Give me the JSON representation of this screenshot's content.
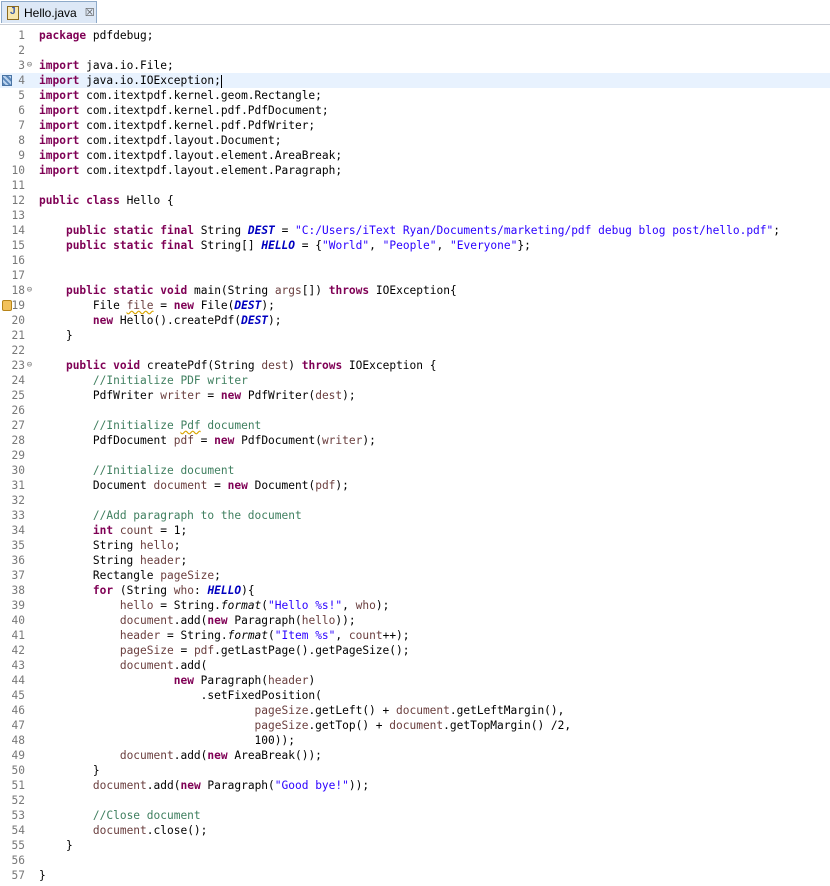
{
  "tab": {
    "title": "Hello.java",
    "close_glyph": "☒",
    "icon": "java-file-icon"
  },
  "colors": {
    "keyword": "#7f0055",
    "string": "#2a00ff",
    "comment": "#3f7f5f",
    "field": "#0000c0",
    "line_number": "#787878",
    "current_line": "#e8f2fe"
  },
  "editor": {
    "current_line": 4,
    "lines": [
      {
        "n": "1",
        "seg": [
          [
            "kw",
            "package"
          ],
          [
            "t",
            " pdfdebug;"
          ]
        ]
      },
      {
        "n": "2",
        "seg": []
      },
      {
        "n": "3",
        "fold": "⊖",
        "seg": [
          [
            "kw",
            "import"
          ],
          [
            "t",
            " java.io.File;"
          ]
        ]
      },
      {
        "n": "4",
        "marker": "change",
        "cursor": true,
        "seg": [
          [
            "kw",
            "import"
          ],
          [
            "t",
            " java.io.IOException;"
          ]
        ]
      },
      {
        "n": "5",
        "seg": [
          [
            "kw",
            "import"
          ],
          [
            "t",
            " com.itextpdf.kernel.geom.Rectangle;"
          ]
        ]
      },
      {
        "n": "6",
        "seg": [
          [
            "kw",
            "import"
          ],
          [
            "t",
            " com.itextpdf.kernel.pdf.PdfDocument;"
          ]
        ]
      },
      {
        "n": "7",
        "seg": [
          [
            "kw",
            "import"
          ],
          [
            "t",
            " com.itextpdf.kernel.pdf.PdfWriter;"
          ]
        ]
      },
      {
        "n": "8",
        "seg": [
          [
            "kw",
            "import"
          ],
          [
            "t",
            " com.itextpdf.layout.Document;"
          ]
        ]
      },
      {
        "n": "9",
        "seg": [
          [
            "kw",
            "import"
          ],
          [
            "t",
            " com.itextpdf.layout.element.AreaBreak;"
          ]
        ]
      },
      {
        "n": "10",
        "seg": [
          [
            "kw",
            "import"
          ],
          [
            "t",
            " com.itextpdf.layout.element.Paragraph;"
          ]
        ]
      },
      {
        "n": "11",
        "seg": []
      },
      {
        "n": "12",
        "seg": [
          [
            "kw",
            "public"
          ],
          [
            "t",
            " "
          ],
          [
            "kw",
            "class"
          ],
          [
            "t",
            " Hello {"
          ]
        ]
      },
      {
        "n": "13",
        "seg": []
      },
      {
        "n": "14",
        "seg": [
          [
            "t",
            "    "
          ],
          [
            "kw",
            "public"
          ],
          [
            "t",
            " "
          ],
          [
            "kw",
            "static"
          ],
          [
            "t",
            " "
          ],
          [
            "kw",
            "final"
          ],
          [
            "t",
            " String "
          ],
          [
            "fld",
            "DEST"
          ],
          [
            "t",
            " = "
          ],
          [
            "str",
            "\"C:/Users/iText Ryan/Documents/marketing/pdf debug blog post/hello.pdf\""
          ],
          [
            "t",
            ";"
          ]
        ]
      },
      {
        "n": "15",
        "seg": [
          [
            "t",
            "    "
          ],
          [
            "kw",
            "public"
          ],
          [
            "t",
            " "
          ],
          [
            "kw",
            "static"
          ],
          [
            "t",
            " "
          ],
          [
            "kw",
            "final"
          ],
          [
            "t",
            " String[] "
          ],
          [
            "fld",
            "HELLO"
          ],
          [
            "t",
            " = {"
          ],
          [
            "str",
            "\"World\""
          ],
          [
            "t",
            ", "
          ],
          [
            "str",
            "\"People\""
          ],
          [
            "t",
            ", "
          ],
          [
            "str",
            "\"Everyone\""
          ],
          [
            "t",
            "};"
          ]
        ]
      },
      {
        "n": "16",
        "seg": []
      },
      {
        "n": "17",
        "seg": []
      },
      {
        "n": "18",
        "fold": "⊖",
        "seg": [
          [
            "t",
            "    "
          ],
          [
            "kw",
            "public"
          ],
          [
            "t",
            " "
          ],
          [
            "kw",
            "static"
          ],
          [
            "t",
            " "
          ],
          [
            "kw",
            "void"
          ],
          [
            "t",
            " main(String "
          ],
          [
            "var",
            "args"
          ],
          [
            "t",
            "[]) "
          ],
          [
            "kw",
            "throws"
          ],
          [
            "t",
            " IOException{"
          ]
        ]
      },
      {
        "n": "19",
        "marker": "warn",
        "seg": [
          [
            "t",
            "        File "
          ],
          [
            "sqv",
            "file"
          ],
          [
            "t",
            " = "
          ],
          [
            "kw",
            "new"
          ],
          [
            "t",
            " File("
          ],
          [
            "fld",
            "DEST"
          ],
          [
            "t",
            ");"
          ]
        ]
      },
      {
        "n": "20",
        "seg": [
          [
            "t",
            "        "
          ],
          [
            "kw",
            "new"
          ],
          [
            "t",
            " Hello().createPdf("
          ],
          [
            "fld",
            "DEST"
          ],
          [
            "t",
            ");"
          ]
        ]
      },
      {
        "n": "21",
        "seg": [
          [
            "t",
            "    }"
          ]
        ]
      },
      {
        "n": "22",
        "seg": []
      },
      {
        "n": "23",
        "fold": "⊖",
        "seg": [
          [
            "t",
            "    "
          ],
          [
            "kw",
            "public"
          ],
          [
            "t",
            " "
          ],
          [
            "kw",
            "void"
          ],
          [
            "t",
            " createPdf(String "
          ],
          [
            "var",
            "dest"
          ],
          [
            "t",
            ") "
          ],
          [
            "kw",
            "throws"
          ],
          [
            "t",
            " IOException {"
          ]
        ]
      },
      {
        "n": "24",
        "seg": [
          [
            "t",
            "        "
          ],
          [
            "cm",
            "//Initialize PDF writer"
          ]
        ]
      },
      {
        "n": "25",
        "seg": [
          [
            "t",
            "        PdfWriter "
          ],
          [
            "var",
            "writer"
          ],
          [
            "t",
            " = "
          ],
          [
            "kw",
            "new"
          ],
          [
            "t",
            " PdfWriter("
          ],
          [
            "var",
            "dest"
          ],
          [
            "t",
            ");"
          ]
        ]
      },
      {
        "n": "26",
        "seg": []
      },
      {
        "n": "27",
        "seg": [
          [
            "t",
            "        "
          ],
          [
            "cm",
            "//Initialize "
          ],
          [
            "cmsq",
            "Pdf"
          ],
          [
            "cm",
            " document"
          ]
        ]
      },
      {
        "n": "28",
        "seg": [
          [
            "t",
            "        PdfDocument "
          ],
          [
            "var",
            "pdf"
          ],
          [
            "t",
            " = "
          ],
          [
            "kw",
            "new"
          ],
          [
            "t",
            " PdfDocument("
          ],
          [
            "var",
            "writer"
          ],
          [
            "t",
            ");"
          ]
        ]
      },
      {
        "n": "29",
        "seg": []
      },
      {
        "n": "30",
        "seg": [
          [
            "t",
            "        "
          ],
          [
            "cm",
            "//Initialize document"
          ]
        ]
      },
      {
        "n": "31",
        "seg": [
          [
            "t",
            "        Document "
          ],
          [
            "var",
            "document"
          ],
          [
            "t",
            " = "
          ],
          [
            "kw",
            "new"
          ],
          [
            "t",
            " Document("
          ],
          [
            "var",
            "pdf"
          ],
          [
            "t",
            ");"
          ]
        ]
      },
      {
        "n": "32",
        "seg": []
      },
      {
        "n": "33",
        "seg": [
          [
            "t",
            "        "
          ],
          [
            "cm",
            "//Add paragraph to the document"
          ]
        ]
      },
      {
        "n": "34",
        "seg": [
          [
            "t",
            "        "
          ],
          [
            "kw",
            "int"
          ],
          [
            "t",
            " "
          ],
          [
            "var",
            "count"
          ],
          [
            "t",
            " = 1;"
          ]
        ]
      },
      {
        "n": "35",
        "seg": [
          [
            "t",
            "        String "
          ],
          [
            "var",
            "hello"
          ],
          [
            "t",
            ";"
          ]
        ]
      },
      {
        "n": "36",
        "seg": [
          [
            "t",
            "        String "
          ],
          [
            "var",
            "header"
          ],
          [
            "t",
            ";"
          ]
        ]
      },
      {
        "n": "37",
        "seg": [
          [
            "t",
            "        Rectangle "
          ],
          [
            "var",
            "pageSize"
          ],
          [
            "t",
            ";"
          ]
        ]
      },
      {
        "n": "38",
        "seg": [
          [
            "t",
            "        "
          ],
          [
            "kw",
            "for"
          ],
          [
            "t",
            " (String "
          ],
          [
            "var",
            "who"
          ],
          [
            "t",
            ": "
          ],
          [
            "fld",
            "HELLO"
          ],
          [
            "t",
            "){"
          ]
        ]
      },
      {
        "n": "39",
        "seg": [
          [
            "t",
            "            "
          ],
          [
            "var",
            "hello"
          ],
          [
            "t",
            " = String."
          ],
          [
            "it",
            "format"
          ],
          [
            "t",
            "("
          ],
          [
            "str",
            "\"Hello %s!\""
          ],
          [
            "t",
            ", "
          ],
          [
            "var",
            "who"
          ],
          [
            "t",
            ");"
          ]
        ]
      },
      {
        "n": "40",
        "seg": [
          [
            "t",
            "            "
          ],
          [
            "var",
            "document"
          ],
          [
            "t",
            ".add("
          ],
          [
            "kw",
            "new"
          ],
          [
            "t",
            " Paragraph("
          ],
          [
            "var",
            "hello"
          ],
          [
            "t",
            "));"
          ]
        ]
      },
      {
        "n": "41",
        "seg": [
          [
            "t",
            "            "
          ],
          [
            "var",
            "header"
          ],
          [
            "t",
            " = String."
          ],
          [
            "it",
            "format"
          ],
          [
            "t",
            "("
          ],
          [
            "str",
            "\"Item %s\""
          ],
          [
            "t",
            ", "
          ],
          [
            "var",
            "count"
          ],
          [
            "t",
            "++);"
          ]
        ]
      },
      {
        "n": "42",
        "seg": [
          [
            "t",
            "            "
          ],
          [
            "var",
            "pageSize"
          ],
          [
            "t",
            " = "
          ],
          [
            "var",
            "pdf"
          ],
          [
            "t",
            ".getLastPage().getPageSize();"
          ]
        ]
      },
      {
        "n": "43",
        "seg": [
          [
            "t",
            "            "
          ],
          [
            "var",
            "document"
          ],
          [
            "t",
            ".add("
          ]
        ]
      },
      {
        "n": "44",
        "seg": [
          [
            "t",
            "                    "
          ],
          [
            "kw",
            "new"
          ],
          [
            "t",
            " Paragraph("
          ],
          [
            "var",
            "header"
          ],
          [
            "t",
            ")"
          ]
        ]
      },
      {
        "n": "45",
        "seg": [
          [
            "t",
            "                        .setFixedPosition("
          ]
        ]
      },
      {
        "n": "46",
        "seg": [
          [
            "t",
            "                                "
          ],
          [
            "var",
            "pageSize"
          ],
          [
            "t",
            ".getLeft() + "
          ],
          [
            "var",
            "document"
          ],
          [
            "t",
            ".getLeftMargin(),"
          ]
        ]
      },
      {
        "n": "47",
        "seg": [
          [
            "t",
            "                                "
          ],
          [
            "var",
            "pageSize"
          ],
          [
            "t",
            ".getTop() + "
          ],
          [
            "var",
            "document"
          ],
          [
            "t",
            ".getTopMargin() /2,"
          ]
        ]
      },
      {
        "n": "48",
        "seg": [
          [
            "t",
            "                                100));"
          ]
        ]
      },
      {
        "n": "49",
        "seg": [
          [
            "t",
            "            "
          ],
          [
            "var",
            "document"
          ],
          [
            "t",
            ".add("
          ],
          [
            "kw",
            "new"
          ],
          [
            "t",
            " AreaBreak());"
          ]
        ]
      },
      {
        "n": "50",
        "seg": [
          [
            "t",
            "        }"
          ]
        ]
      },
      {
        "n": "51",
        "seg": [
          [
            "t",
            "        "
          ],
          [
            "var",
            "document"
          ],
          [
            "t",
            ".add("
          ],
          [
            "kw",
            "new"
          ],
          [
            "t",
            " Paragraph("
          ],
          [
            "str",
            "\"Good bye!\""
          ],
          [
            "t",
            "));"
          ]
        ]
      },
      {
        "n": "52",
        "seg": []
      },
      {
        "n": "53",
        "seg": [
          [
            "t",
            "        "
          ],
          [
            "cm",
            "//Close document"
          ]
        ]
      },
      {
        "n": "54",
        "seg": [
          [
            "t",
            "        "
          ],
          [
            "var",
            "document"
          ],
          [
            "t",
            ".close();"
          ]
        ]
      },
      {
        "n": "55",
        "seg": [
          [
            "t",
            "    }"
          ]
        ]
      },
      {
        "n": "56",
        "seg": []
      },
      {
        "n": "57",
        "seg": [
          [
            "t",
            "}"
          ]
        ]
      }
    ]
  }
}
